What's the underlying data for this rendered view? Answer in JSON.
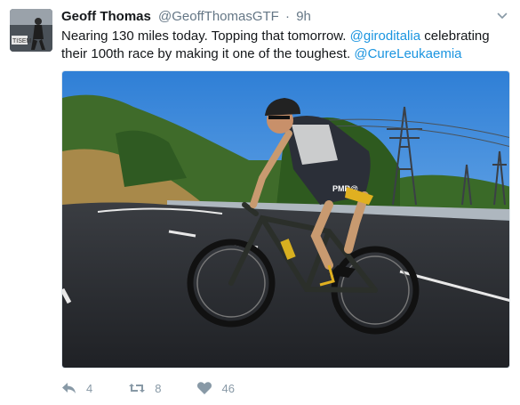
{
  "tweet": {
    "author_name": "Geoff Thomas",
    "author_handle": "@GeoffThomasGTF",
    "separator": "·",
    "timestamp": "9h",
    "text_1": "Nearing 130 miles today. Topping that tomorrow. ",
    "mention_1": "@giroditalia",
    "text_2": " celebrating their 100th race by making it one of the toughest. ",
    "mention_2": "@CureLeukaemia",
    "avatar_label": "TISEM",
    "jersey_text": "PMR@"
  },
  "actions": {
    "reply_count": "4",
    "retweet_count": "8",
    "like_count": "46"
  },
  "icons": {
    "reply": "reply-icon",
    "retweet": "retweet-icon",
    "like": "heart-icon",
    "menu": "chevron-down-icon"
  },
  "colors": {
    "link": "#1b95e0",
    "muted": "#657786",
    "action_icon": "#8899a6"
  }
}
